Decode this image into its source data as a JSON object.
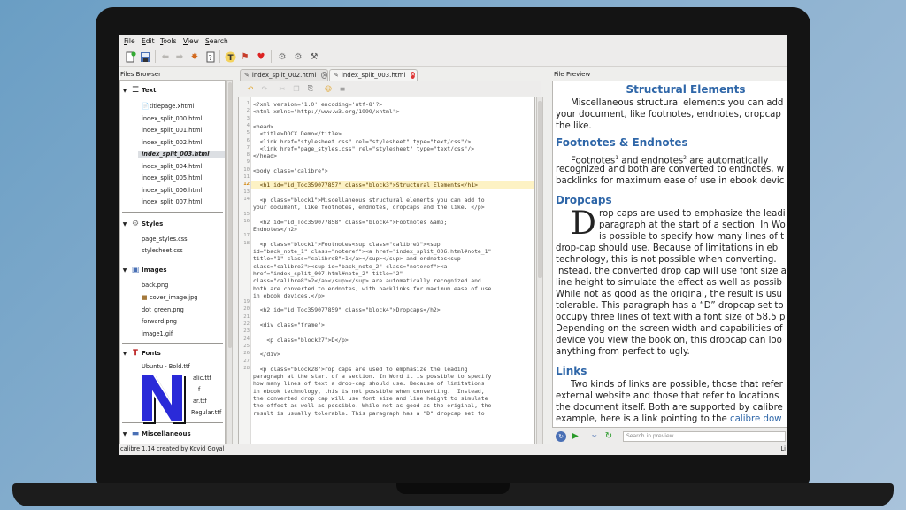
{
  "menu": [
    {
      "label": "File",
      "ul": "F",
      "rest": "ile"
    },
    {
      "label": "Edit",
      "ul": "E",
      "rest": "dit"
    },
    {
      "label": "Tools",
      "ul": "T",
      "rest": "ools"
    },
    {
      "label": "View",
      "ul": "V",
      "rest": "iew"
    },
    {
      "label": "Search",
      "ul": "S",
      "rest": "earch"
    }
  ],
  "files_browser": {
    "title": "Files Browser",
    "categories": {
      "text": "Text",
      "styles": "Styles",
      "images": "Images",
      "fonts": "Fonts",
      "misc": "Miscellaneous"
    },
    "text_files": [
      "titlepage.xhtml",
      "index_split_000.html",
      "index_split_001.html",
      "index_split_002.html",
      "index_split_003.html",
      "index_split_004.html",
      "index_split_005.html",
      "index_split_006.html",
      "index_split_007.html"
    ],
    "selected_file": "index_split_003.html",
    "style_files": [
      "page_styles.css",
      "stylesheet.css"
    ],
    "image_files": [
      "back.png",
      "cover_image.jpg",
      "dot_green.png",
      "forward.png",
      "image1.gif"
    ],
    "font_files": [
      "Ubuntu - Bold.ttf",
      "alic.ttf",
      "f",
      "ar.ttf",
      "Regular.ttf"
    ]
  },
  "tabs": [
    {
      "label": "index_split_002.html",
      "active": false
    },
    {
      "label": "index_split_003.html",
      "active": true
    }
  ],
  "code": {
    "highlighted_line": "12",
    "lines": [
      {
        "n": "1",
        "t": "<?xml version='1.0' encoding='utf-8'?>"
      },
      {
        "n": "2",
        "t": "<html xmlns=\"http://www.w3.org/1999/xhtml\">"
      },
      {
        "n": "3",
        "t": ""
      },
      {
        "n": "4",
        "t": "<head>"
      },
      {
        "n": "5",
        "t": "  <title>DOCX Demo</title>"
      },
      {
        "n": "6",
        "t": "  <link href=\"stylesheet.css\" rel=\"stylesheet\" type=\"text/css\"/>"
      },
      {
        "n": "7",
        "t": "  <link href=\"page_styles.css\" rel=\"stylesheet\" type=\"text/css\"/>"
      },
      {
        "n": "8",
        "t": "</head>"
      },
      {
        "n": "9",
        "t": ""
      },
      {
        "n": "10",
        "t": "<body class=\"calibre\">"
      },
      {
        "n": "11",
        "t": ""
      },
      {
        "n": "12",
        "t": "  <h1 id=\"id_Toc359077857\" class=\"block3\">Structural Elements</h1>"
      },
      {
        "n": "13",
        "t": ""
      },
      {
        "n": "14",
        "t": "  <p class=\"block1\">Miscellaneous structural elements you can add to"
      },
      {
        "n": "",
        "t": "your document, like footnotes, endnotes, dropcaps and the like. </p>"
      },
      {
        "n": "15",
        "t": ""
      },
      {
        "n": "16",
        "t": "  <h2 id=\"id_Toc359077858\" class=\"block4\">Footnotes &amp;"
      },
      {
        "n": "",
        "t": "Endnotes</h2>"
      },
      {
        "n": "17",
        "t": ""
      },
      {
        "n": "18",
        "t": "  <p class=\"block1\">Footnotes<sup class=\"calibre3\"><sup"
      },
      {
        "n": "",
        "t": "id=\"back_note_1\" class=\"noteref\"><a href=\"index_split_006.html#note_1\""
      },
      {
        "n": "",
        "t": "title=\"1\" class=\"calibre8\">1</a></sup></sup> and endnotes<sup"
      },
      {
        "n": "",
        "t": "class=\"calibre3\"><sup id=\"back_note_2\" class=\"noteref\"><a"
      },
      {
        "n": "",
        "t": "href=\"index_split_007.html#note_2\" title=\"2\""
      },
      {
        "n": "",
        "t": "class=\"calibre8\">2</a></sup></sup> are automatically recognized and"
      },
      {
        "n": "",
        "t": "both are converted to endnotes, with backlinks for maximum ease of use"
      },
      {
        "n": "",
        "t": "in ebook devices.</p>"
      },
      {
        "n": "19",
        "t": ""
      },
      {
        "n": "20",
        "t": "  <h2 id=\"id_Toc359077859\" class=\"block4\">Dropcaps</h2>"
      },
      {
        "n": "21",
        "t": ""
      },
      {
        "n": "22",
        "t": "  <div class=\"frame\">"
      },
      {
        "n": "23",
        "t": ""
      },
      {
        "n": "24",
        "t": "    <p class=\"block27\">D</p>"
      },
      {
        "n": "25",
        "t": ""
      },
      {
        "n": "26",
        "t": "  </div>"
      },
      {
        "n": "27",
        "t": ""
      },
      {
        "n": "28",
        "t": "  <p class=\"block28\">rop caps are used to emphasize the leading"
      },
      {
        "n": "",
        "t": "paragraph at the start of a section. In Word it is possible to specify"
      },
      {
        "n": "",
        "t": "how many lines of text a drop-cap should use. Because of limitations"
      },
      {
        "n": "",
        "t": "in ebook technology, this is not possible when converting.  Instead,"
      },
      {
        "n": "",
        "t": "the converted drop cap will use font size and line height to simulate"
      },
      {
        "n": "",
        "t": "the effect as well as possible. While not as good as the original, the"
      },
      {
        "n": "",
        "t": "result is usually tolerable. This paragraph has a \"D\" dropcap set to"
      }
    ]
  },
  "preview": {
    "title": "File Preview",
    "h1": "Structural Elements",
    "intro": [
      "Miscellaneous structural elements you can add",
      "your document, like footnotes, endnotes, dropcap",
      "the like."
    ],
    "h2_footnotes": "Footnotes & Endnotes",
    "fn_line1_a": "Footnotes",
    "fn_sup1": "1",
    "fn_line1_b": " and endnotes",
    "fn_sup2": "2",
    "fn_line1_c": " are automatically",
    "fn_rest": [
      "recognized and both are converted to endnotes, w",
      "backlinks for maximum ease of use in ebook devic"
    ],
    "h2_dropcaps": "Dropcaps",
    "dropcap_letter": "D",
    "dropcap_lines": [
      "rop caps are used to emphasize the leadi",
      "paragraph at the start of a section. In Wo",
      "is possible to specify how many lines of t",
      "drop-cap should use. Because of limitations in eb",
      "technology, this is not possible when converting.",
      "Instead, the converted drop cap will use font size a",
      "line height to simulate the effect as well as possib",
      "While not as good as the original, the result is usu",
      "tolerable. This paragraph has a “D” dropcap set to",
      "occupy three lines of text with a font size of 58.5 p",
      "Depending on the screen width and capabilities of",
      "device you view the book on, this dropcap can loo",
      "anything from perfect to ugly."
    ],
    "h2_links": "Links",
    "links_lines": [
      "Two kinds of links are possible, those that refer",
      "external website and those that refer to locations",
      "the document itself. Both are supported by calibre"
    ],
    "links_last_prefix": "example, here is a link pointing to the ",
    "links_last_link": "calibre dow",
    "search_placeholder": "Search in preview"
  },
  "status": {
    "left": "calibre 1.14 created by Kovid Goyal",
    "right": "Li"
  },
  "colors": {
    "accent": "#2e66a8",
    "highlight": "#fdf2c4",
    "logo_blue": "#2a2ad8"
  }
}
